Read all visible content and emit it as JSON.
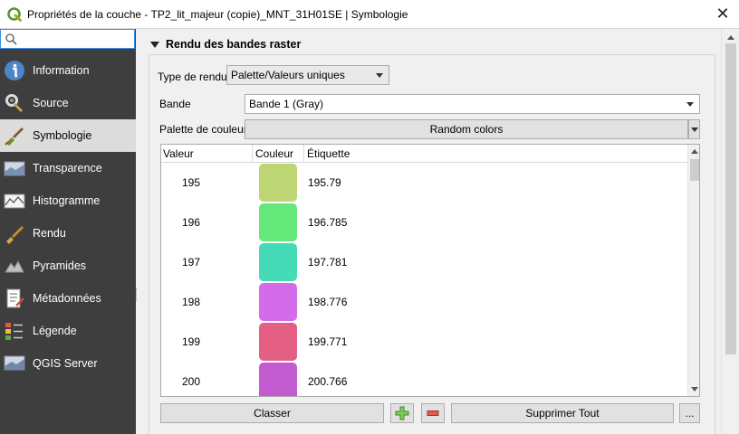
{
  "window": {
    "title": "Propriétés de la couche - TP2_lit_majeur (copie)_MNT_31H01SE | Symbologie",
    "close_glyph": "✕"
  },
  "search": {
    "value": "",
    "placeholder": ""
  },
  "sidebar": {
    "items": [
      {
        "label": "Information",
        "icon": "information-icon",
        "active": false
      },
      {
        "label": "Source",
        "icon": "source-icon",
        "active": false
      },
      {
        "label": "Symbologie",
        "icon": "symbology-icon",
        "active": true
      },
      {
        "label": "Transparence",
        "icon": "transparency-icon",
        "active": false
      },
      {
        "label": "Histogramme",
        "icon": "histogram-icon",
        "active": false
      },
      {
        "label": "Rendu",
        "icon": "rendering-icon",
        "active": false
      },
      {
        "label": "Pyramides",
        "icon": "pyramids-icon",
        "active": false
      },
      {
        "label": "Métadonnées",
        "icon": "metadata-icon",
        "active": false
      },
      {
        "label": "Légende",
        "icon": "legend-icon",
        "active": false
      },
      {
        "label": "QGIS Server",
        "icon": "qgis-server-icon",
        "active": false
      }
    ]
  },
  "section": {
    "title": "Rendu des bandes raster"
  },
  "form": {
    "render_type_label": "Type de rendu",
    "render_type_value": "Palette/Valeurs uniques",
    "band_label": "Bande",
    "band_value": "Bande 1 (Gray)",
    "palette_label": "Palette de couleur",
    "palette_value": "Random colors"
  },
  "table": {
    "headers": {
      "value": "Valeur",
      "color": "Couleur",
      "label": "Étiquette"
    },
    "rows": [
      {
        "value": "195",
        "color": "#bdd574",
        "label": "195.79"
      },
      {
        "value": "196",
        "color": "#64e87a",
        "label": "196.785"
      },
      {
        "value": "197",
        "color": "#45dbb6",
        "label": "197.781"
      },
      {
        "value": "198",
        "color": "#d46be9",
        "label": "198.776"
      },
      {
        "value": "199",
        "color": "#e36084",
        "label": "199.771"
      },
      {
        "value": "200",
        "color": "#c15bcf",
        "label": "200.766"
      }
    ]
  },
  "actions": {
    "classify_label": "Classer",
    "delete_all_label": "Supprimer Tout",
    "more_label": "..."
  }
}
